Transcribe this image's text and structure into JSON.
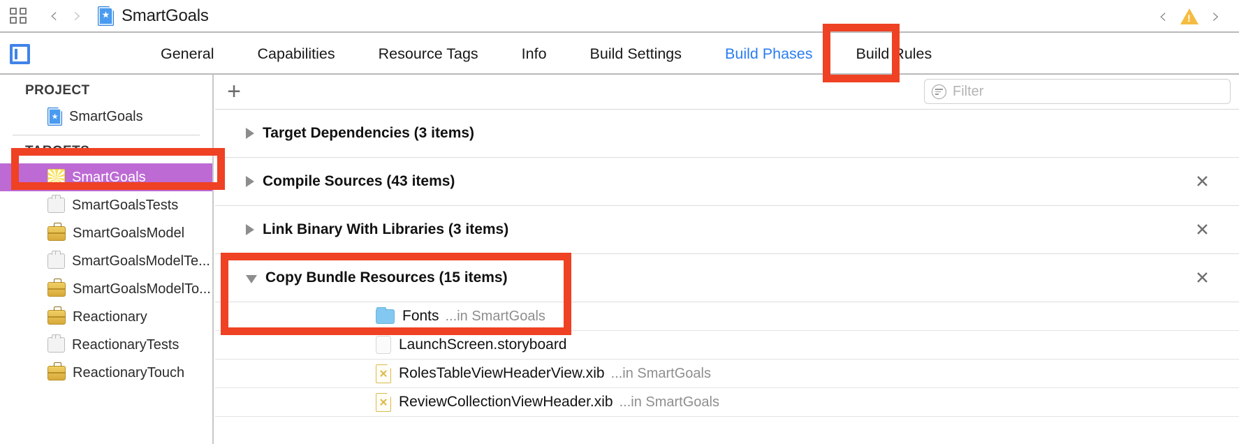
{
  "window": {
    "breadcrumb_title": "SmartGoals",
    "nav_back_icon": "chevron-left-icon",
    "nav_forward_icon": "chevron-right-icon",
    "grid_icon": "grid-layout-icon",
    "issue_prev_icon": "chevron-left-icon",
    "issue_warning_icon": "warning-triangle-icon",
    "issue_next_icon": "chevron-right-icon"
  },
  "tabs": {
    "active": "Build Phases",
    "items": [
      {
        "label": "General",
        "active": false
      },
      {
        "label": "Capabilities",
        "active": false
      },
      {
        "label": "Resource Tags",
        "active": false
      },
      {
        "label": "Info",
        "active": false
      },
      {
        "label": "Build Settings",
        "active": false
      },
      {
        "label": "Build Phases",
        "active": true
      },
      {
        "label": "Build Rules",
        "active": false
      }
    ],
    "panel_toggle_icon": "left-panel-toggle-icon"
  },
  "sidebar": {
    "project_header": "PROJECT",
    "targets_header": "TARGETS",
    "project_items": [
      {
        "label": "SmartGoals",
        "icon": "xcode-project-icon"
      }
    ],
    "target_items": [
      {
        "label": "SmartGoals",
        "icon": "app-target-icon",
        "selected": true
      },
      {
        "label": "SmartGoalsTests",
        "icon": "test-bundle-icon",
        "selected": false
      },
      {
        "label": "SmartGoalsModel",
        "icon": "framework-target-icon",
        "selected": false
      },
      {
        "label": "SmartGoalsModelTe...",
        "icon": "test-bundle-icon",
        "selected": false
      },
      {
        "label": "SmartGoalsModelTo...",
        "icon": "framework-target-icon",
        "selected": false
      },
      {
        "label": "Reactionary",
        "icon": "framework-target-icon",
        "selected": false
      },
      {
        "label": "ReactionaryTests",
        "icon": "test-bundle-icon",
        "selected": false
      },
      {
        "label": "ReactionaryTouch",
        "icon": "framework-target-icon",
        "selected": false
      }
    ]
  },
  "main": {
    "add_phase_label": "+",
    "add_phase_icon": "plus-icon",
    "filter": {
      "placeholder": "Filter",
      "value": "",
      "icon": "filter-icon"
    },
    "phases": [
      {
        "title": "Target Dependencies (3 items)",
        "expanded": false,
        "removable": false,
        "disclosure_icon": "triangle-right-icon"
      },
      {
        "title": "Compile Sources (43 items)",
        "expanded": false,
        "removable": true,
        "disclosure_icon": "triangle-right-icon",
        "remove_icon": "close-x-icon"
      },
      {
        "title": "Link Binary With Libraries (3 items)",
        "expanded": false,
        "removable": true,
        "disclosure_icon": "triangle-right-icon",
        "remove_icon": "close-x-icon"
      },
      {
        "title": "Copy Bundle Resources (15 items)",
        "expanded": true,
        "removable": true,
        "disclosure_icon": "triangle-down-icon",
        "remove_icon": "close-x-icon"
      }
    ],
    "copy_bundle_files": [
      {
        "name": "Fonts",
        "location": "...in SmartGoals",
        "icon": "folder-icon"
      },
      {
        "name": "LaunchScreen.storyboard",
        "location": "",
        "icon": "storyboard-icon"
      },
      {
        "name": "RolesTableViewHeaderView.xib",
        "location": "...in SmartGoals",
        "icon": "xib-icon"
      },
      {
        "name": "ReviewCollectionViewHeader.xib",
        "location": "...in SmartGoals",
        "icon": "xib-icon"
      }
    ]
  },
  "annotations": {
    "highlight_color": "#ef4123",
    "boxes": [
      {
        "name": "build-phases-tab-highlight"
      },
      {
        "name": "smartgoals-target-highlight"
      },
      {
        "name": "copy-bundle-resources-highlight"
      }
    ]
  },
  "colors": {
    "accent_blue": "#2b7df0",
    "selection_purple": "#bd6ad4",
    "warning_yellow": "#f5bc42",
    "annotation_red": "#ef4123"
  }
}
